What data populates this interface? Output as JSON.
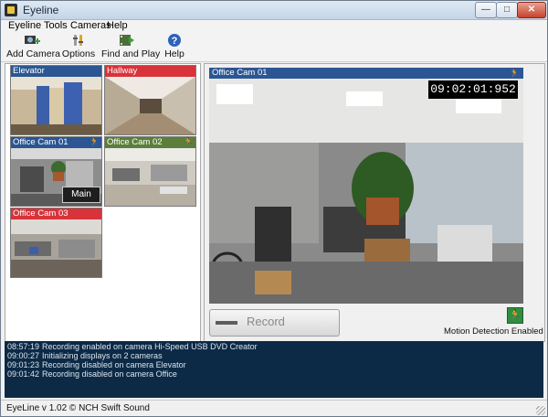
{
  "window": {
    "title": "Eyeline",
    "minimize": "—",
    "maximize": "□",
    "close": "✕"
  },
  "menu": [
    "Eyeline",
    "Tools",
    "Cameras",
    "Help"
  ],
  "toolbar": [
    {
      "label": "Add Camera",
      "icon": "add-camera-icon"
    },
    {
      "label": "Options",
      "icon": "options-icon"
    },
    {
      "label": "Find and Play",
      "icon": "find-and-play-icon"
    },
    {
      "label": "Help",
      "icon": "help-icon"
    }
  ],
  "cameras": [
    {
      "name": "Elevator",
      "header_color": "#2b5693"
    },
    {
      "name": "Hallway",
      "header_color": "#d8333b"
    },
    {
      "name": "Office Cam 01",
      "header_color": "#2b5693",
      "badge": "Main"
    },
    {
      "name": "Office Cam 02",
      "header_color": "#5b7f3a"
    },
    {
      "name": "Office Cam 03",
      "header_color": "#d8333b"
    }
  ],
  "main_view": {
    "title": "Office Cam 01",
    "timestamp": "09:02:01:952",
    "record_label": "Record",
    "motion_label": "Motion Detection Enabled"
  },
  "log": [
    {
      "time": "08:57:19",
      "message": "Recording enabled on camera Hi-Speed USB DVD Creator"
    },
    {
      "time": "09:00:27",
      "message": "Initializing displays on 2 cameras"
    },
    {
      "time": "09:01:23",
      "message": "Recording disabled on camera Elevator"
    },
    {
      "time": "09:01:42",
      "message": "Recording disabled on camera Office"
    }
  ],
  "status": "EyeLine v 1.02 © NCH Swift Sound",
  "colors": {
    "accent_blue": "#2b5693",
    "alert_red": "#d8333b",
    "green": "#5b7f3a",
    "log_bg": "#0c2a46"
  }
}
